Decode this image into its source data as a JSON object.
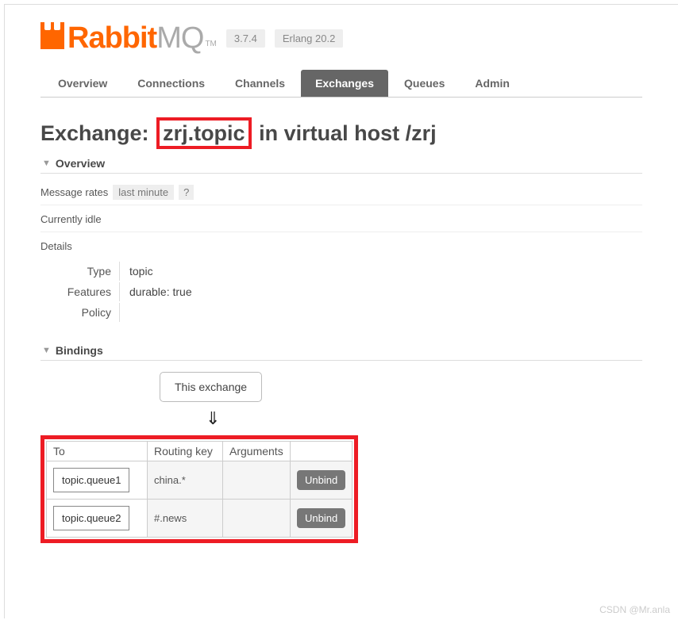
{
  "logo": {
    "part1": "Rabbit",
    "part2": "MQ",
    "tm": "TM"
  },
  "versions": {
    "rabbit": "3.7.4",
    "erlang": "Erlang 20.2"
  },
  "tabs": [
    {
      "label": "Overview",
      "active": false
    },
    {
      "label": "Connections",
      "active": false
    },
    {
      "label": "Channels",
      "active": false
    },
    {
      "label": "Exchanges",
      "active": true
    },
    {
      "label": "Queues",
      "active": false
    },
    {
      "label": "Admin",
      "active": false
    }
  ],
  "title": {
    "prefix": "Exchange:",
    "name": "zrj.topic",
    "mid": "in virtual host",
    "vhost": "/zrj"
  },
  "section_overview": "Overview",
  "rates": {
    "label": "Message rates",
    "range": "last minute",
    "help": "?"
  },
  "idle_text": "Currently idle",
  "details_label": "Details",
  "details": {
    "type_label": "Type",
    "type_value": "topic",
    "features_label": "Features",
    "features_value": "durable: true",
    "policy_label": "Policy",
    "policy_value": ""
  },
  "section_bindings": "Bindings",
  "this_exchange": "This exchange",
  "arrow": "⇓",
  "bindings_table": {
    "headers": {
      "to": "To",
      "rk": "Routing key",
      "args": "Arguments",
      "act": ""
    },
    "rows": [
      {
        "to": "topic.queue1",
        "rk": "china.*",
        "args": "",
        "action": "Unbind"
      },
      {
        "to": "topic.queue2",
        "rk": "#.news",
        "args": "",
        "action": "Unbind"
      }
    ]
  },
  "watermark": "CSDN @Mr.anla"
}
